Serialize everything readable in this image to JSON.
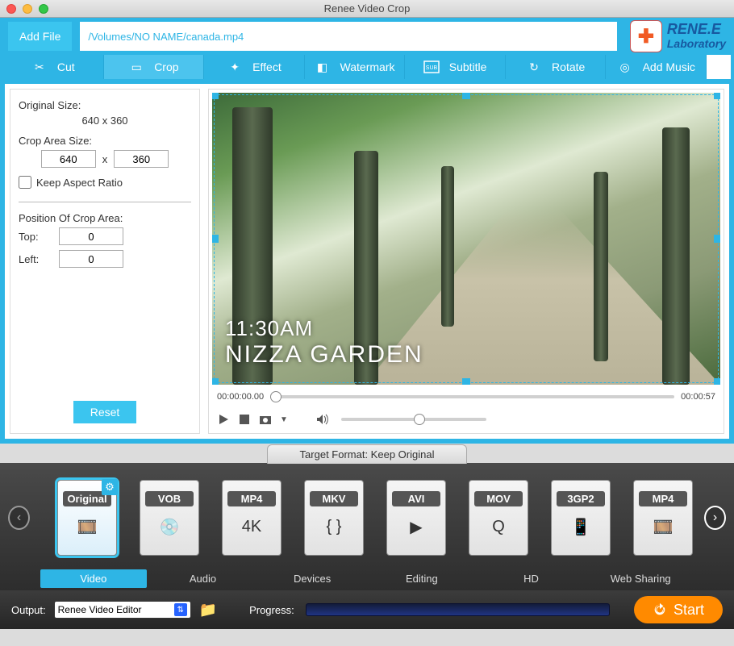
{
  "window": {
    "title": "Renee Video Crop"
  },
  "brand": {
    "line1": "RENE.E",
    "line2": "Laboratory"
  },
  "filebar": {
    "add_file": "Add File",
    "path": "/Volumes/NO NAME/canada.mp4"
  },
  "tabs": {
    "cut": "Cut",
    "crop": "Crop",
    "effect": "Effect",
    "watermark": "Watermark",
    "subtitle": "Subtitle",
    "rotate": "Rotate",
    "add_music": "Add Music",
    "active": "crop"
  },
  "crop_panel": {
    "orig_label": "Original Size:",
    "orig_value": "640 x 360",
    "area_label": "Crop Area Size:",
    "w": "640",
    "x": "x",
    "h": "360",
    "keep_ratio": "Keep Aspect Ratio",
    "pos_label": "Position Of Crop Area:",
    "top_label": "Top:",
    "top": "0",
    "left_label": "Left:",
    "left": "0",
    "reset": "Reset"
  },
  "preview": {
    "overlay_time": "11:30AM",
    "overlay_place": "NIZZA GARDEN",
    "time_start": "00:00:00.00",
    "time_end": "00:00:57"
  },
  "target": {
    "label": "Target Format: Keep Original"
  },
  "formats": {
    "items": [
      {
        "name": "Original",
        "selected": true
      },
      {
        "name": "VOB"
      },
      {
        "name": "MP4"
      },
      {
        "name": "MKV"
      },
      {
        "name": "AVI"
      },
      {
        "name": "MOV"
      },
      {
        "name": "3GP2"
      },
      {
        "name": "MP4"
      }
    ]
  },
  "categories": {
    "video": "Video",
    "audio": "Audio",
    "devices": "Devices",
    "editing": "Editing",
    "hd": "HD",
    "web": "Web Sharing",
    "active": "video"
  },
  "footer": {
    "output_label": "Output:",
    "output_select": "Renee Video Editor",
    "progress_label": "Progress:",
    "start": "Start"
  }
}
